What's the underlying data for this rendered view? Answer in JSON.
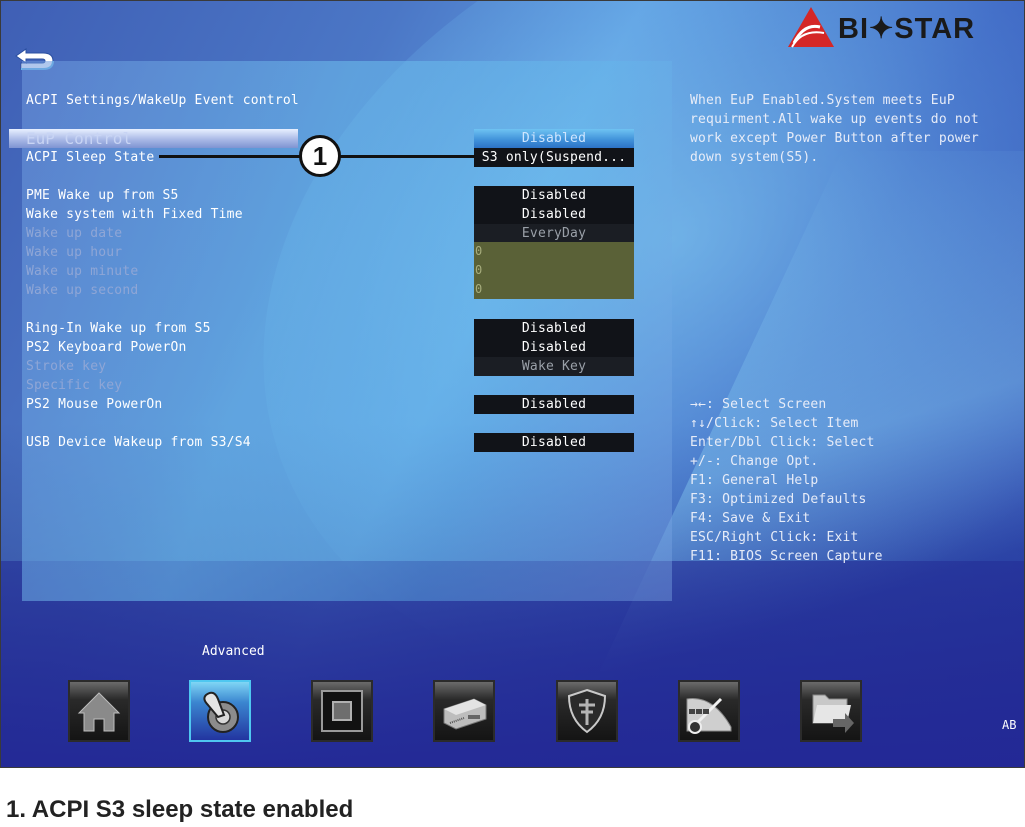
{
  "header": {
    "brand": "BI✦STAR",
    "back_icon": "back-arrow-icon"
  },
  "page_title": "ACPI Settings/WakeUp Event control",
  "settings": [
    {
      "label": "EuP Control",
      "value": "Disabled",
      "state": "selected"
    },
    {
      "label": "ACPI Sleep State",
      "value": "S3 only(Suspend...",
      "state": "normal"
    },
    {
      "label": "PME Wake up from S5",
      "value": "Disabled",
      "state": "normal"
    },
    {
      "label": "Wake system with Fixed Time",
      "value": "Disabled",
      "state": "normal"
    },
    {
      "label": "Wake up date",
      "value": "EveryDay",
      "state": "disabled"
    },
    {
      "label": "Wake up hour",
      "value": "0",
      "state": "disabled"
    },
    {
      "label": "Wake up minute",
      "value": "0",
      "state": "disabled"
    },
    {
      "label": "Wake up second",
      "value": "0",
      "state": "disabled"
    },
    {
      "label": "Ring-In Wake up from S5",
      "value": "Disabled",
      "state": "normal"
    },
    {
      "label": "PS2 Keyboard PowerOn",
      "value": "Disabled",
      "state": "normal"
    },
    {
      "label": "Stroke key",
      "value": "Wake Key",
      "state": "disabled"
    },
    {
      "label": "Specific key",
      "value": "",
      "state": "disabled"
    },
    {
      "label": "PS2 Mouse PowerOn",
      "value": "Disabled",
      "state": "normal"
    },
    {
      "label": "USB Device Wakeup from S3/S4",
      "value": "Disabled",
      "state": "normal"
    }
  ],
  "help_text": [
    "When EuP Enabled.System meets EuP",
    "requirment.All wake up events do not",
    "work except Power Button after power",
    "down system(S5)."
  ],
  "key_help": [
    "→←: Select Screen",
    "↑↓/Click: Select Item",
    "Enter/Dbl Click: Select",
    "+/-: Change Opt.",
    "F1: General Help",
    "F3: Optimized Defaults",
    "F4: Save & Exit",
    "ESC/Right Click: Exit",
    "F11: BIOS Screen Capture"
  ],
  "nav": {
    "active_label": "Advanced",
    "items": [
      {
        "name": "main",
        "icon": "home-icon"
      },
      {
        "name": "advanced",
        "icon": "toggle-switch-icon",
        "active": true
      },
      {
        "name": "chipset",
        "icon": "chip-icon"
      },
      {
        "name": "boot",
        "icon": "drive-icon"
      },
      {
        "name": "security",
        "icon": "shield-icon"
      },
      {
        "name": "o.n.e",
        "icon": "speedometer-icon"
      },
      {
        "name": "save-exit",
        "icon": "folder-exit-icon"
      }
    ]
  },
  "language": "AB",
  "callout": {
    "number": "1"
  },
  "caption": "1. ACPI S3 sleep state enabled"
}
